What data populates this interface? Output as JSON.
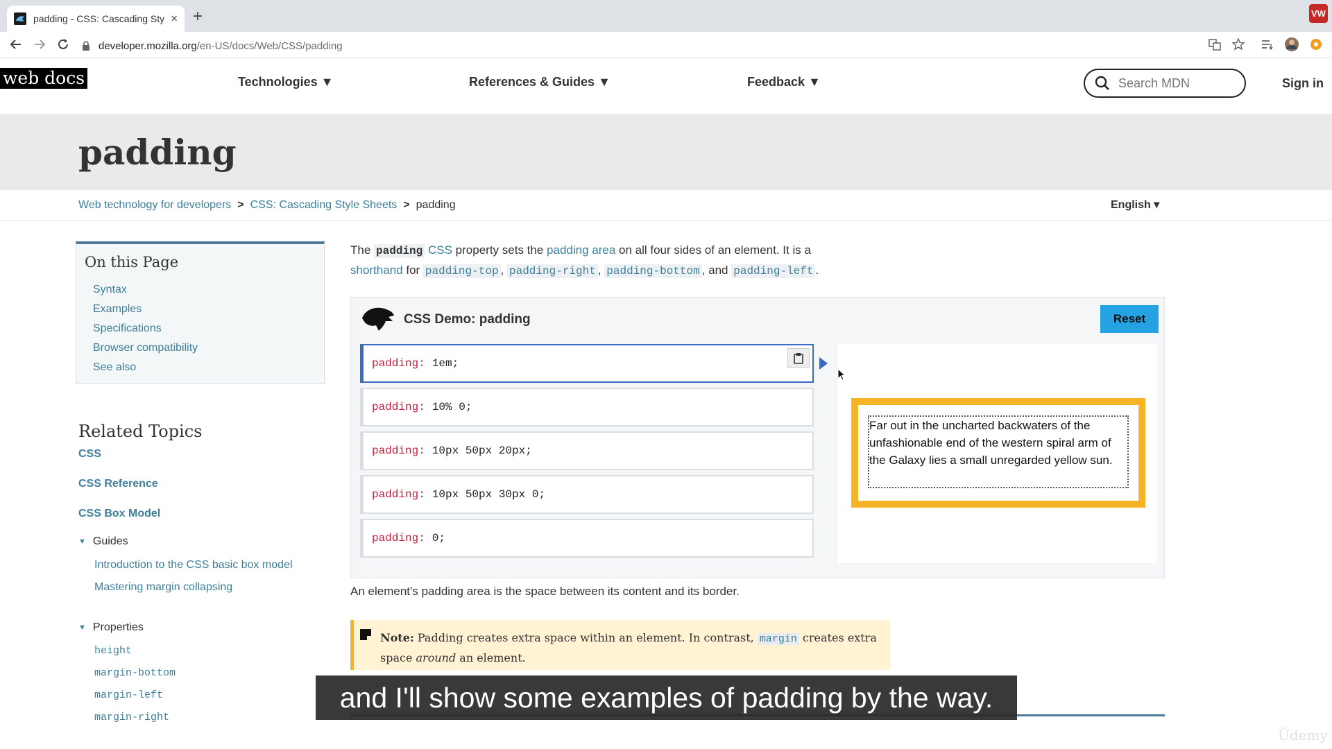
{
  "browser": {
    "tab_title": "padding - CSS: Cascading Styl",
    "tab_close": "×",
    "new_tab": "+",
    "url_host": "developer.mozilla.org",
    "url_path": "/en-US/docs/Web/CSS/padding",
    "extension_badge": "VW"
  },
  "header": {
    "logo": "web docs",
    "nav": [
      "Technologies ▼",
      "References & Guides ▼",
      "Feedback ▼"
    ],
    "search_placeholder": "Search MDN",
    "signin": "Sign in"
  },
  "page": {
    "title": "padding",
    "breadcrumb": [
      "Web technology for developers",
      "CSS: Cascading Style Sheets",
      "padding"
    ],
    "language": "English ▾"
  },
  "sidebar": {
    "on_this_page_title": "On this Page",
    "on_this_page": [
      "Syntax",
      "Examples",
      "Specifications",
      "Browser compatibility",
      "See also"
    ],
    "related_title": "Related Topics",
    "related_links": [
      "CSS",
      "CSS Reference",
      "CSS Box Model"
    ],
    "guides_label": "Guides",
    "guides": [
      "Introduction to the CSS basic box model",
      "Mastering margin collapsing"
    ],
    "properties_label": "Properties",
    "properties": [
      "height",
      "margin-bottom",
      "margin-left",
      "margin-right"
    ]
  },
  "intro": {
    "t1": "The ",
    "code_padding": "padding",
    "link_css": "CSS",
    "t2": " property sets the ",
    "link_padding_area": "padding area",
    "t3": " on all four sides of an element. It is a ",
    "link_shorthand": "shorthand",
    "t4": " for ",
    "c_top": "padding-top",
    "sep1": ", ",
    "c_right": "padding-right",
    "sep2": ", ",
    "c_bottom": "padding-bottom",
    "t5": ", and ",
    "c_left": "padding-left",
    "t6": "."
  },
  "demo": {
    "title": "CSS Demo: padding",
    "reset": "Reset",
    "property": "padding:",
    "choices": [
      "1em;",
      "10% 0;",
      "10px 50px 20px;",
      "10px 50px 30px 0;",
      "0;"
    ],
    "selected_index": 0,
    "output_text": "Far out in the uncharted backwaters of the unfashionable end of the western spiral arm of the Galaxy lies a small unregarded yellow sun."
  },
  "para2": "An element's padding area is the space between its content and its border.",
  "note": {
    "label": "Note:",
    "t1": " Padding creates extra space within an element. In contrast, ",
    "code": "margin",
    "t2": " creates extra space ",
    "em": "around",
    "t3": " an element."
  },
  "overlay": {
    "caption": "and I'll show some examples of padding by the way.",
    "watermark": "Üdemy"
  },
  "colors": {
    "link": "#3d7e9a",
    "reset_button": "#25a2e3",
    "selected_border": "#3b6bc4",
    "demo_border": "#f4b425",
    "css_property": "#c41e3a"
  }
}
